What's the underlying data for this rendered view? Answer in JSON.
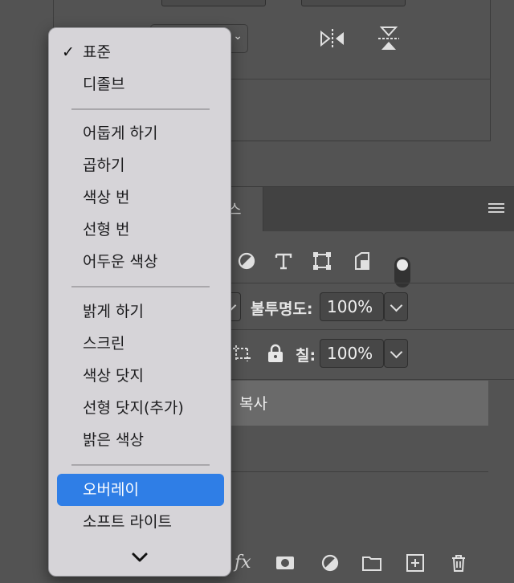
{
  "blend_menu": {
    "groups": [
      [
        {
          "label": "표준",
          "checked": true
        },
        {
          "label": "디졸브"
        }
      ],
      [
        {
          "label": "어둡게 하기"
        },
        {
          "label": "곱하기"
        },
        {
          "label": "색상 번"
        },
        {
          "label": "선형 번"
        },
        {
          "label": "어두운 색상"
        }
      ],
      [
        {
          "label": "밝게 하기"
        },
        {
          "label": "스크린"
        },
        {
          "label": "색상 닷지"
        },
        {
          "label": "선형 닷지(추가)"
        },
        {
          "label": "밝은 색상"
        }
      ],
      [
        {
          "label": "오버레이",
          "highlighted": true
        },
        {
          "label": "소프트 라이트"
        }
      ]
    ],
    "checkmark": "✓",
    "more_icon": "chevron-down-icon"
  },
  "layers_panel": {
    "tab_label": "스",
    "opacity_label": "불투명도:",
    "opacity_value": "100%",
    "fill_label": "칠:",
    "fill_value": "100%",
    "layers": [
      {
        "name": "복사",
        "selected": true
      },
      {
        "name": ""
      }
    ],
    "footer_fx": "fx"
  },
  "colors": {
    "panel_bg": "#535353",
    "menu_bg": "#d6d4d8",
    "highlight": "#2f7ee6",
    "selected_row": "#6a6a6a"
  }
}
